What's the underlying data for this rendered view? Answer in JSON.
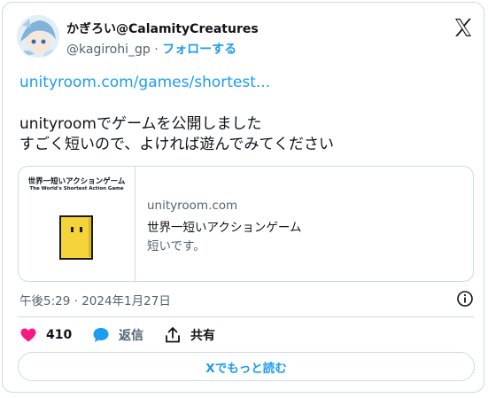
{
  "author": {
    "display_name": "かぎろい@CalamityCreatures",
    "handle": "@kagirohi_gp",
    "separator": "·",
    "follow_label": "フォローする"
  },
  "tweet": {
    "link_text": "unityroom.com/games/shortest...",
    "text_line1": "unityroomでゲームを公開しました",
    "text_line2": "すごく短いので、よければ遊んでみてください"
  },
  "preview_card": {
    "thumb_title": "世界一短いアクションゲーム",
    "thumb_subtitle": "The World's Shortest Action Game",
    "domain": "unityroom.com",
    "title": "世界一短いアクションゲーム",
    "description": "短いです。"
  },
  "timestamp": "午後5:29 · 2024年1月27日",
  "actions": {
    "like_count": "410",
    "reply_label": "返信",
    "share_label": "共有"
  },
  "read_more_label": "Xでもっと読む",
  "colors": {
    "accent": "#1d9bf0",
    "like": "#f91880",
    "secondary_text": "#536471",
    "border": "#cfd9de",
    "game_character": "#f5d33a"
  },
  "icons": [
    "x-logo-icon",
    "info-icon",
    "heart-icon",
    "reply-bubble-icon",
    "share-icon"
  ]
}
